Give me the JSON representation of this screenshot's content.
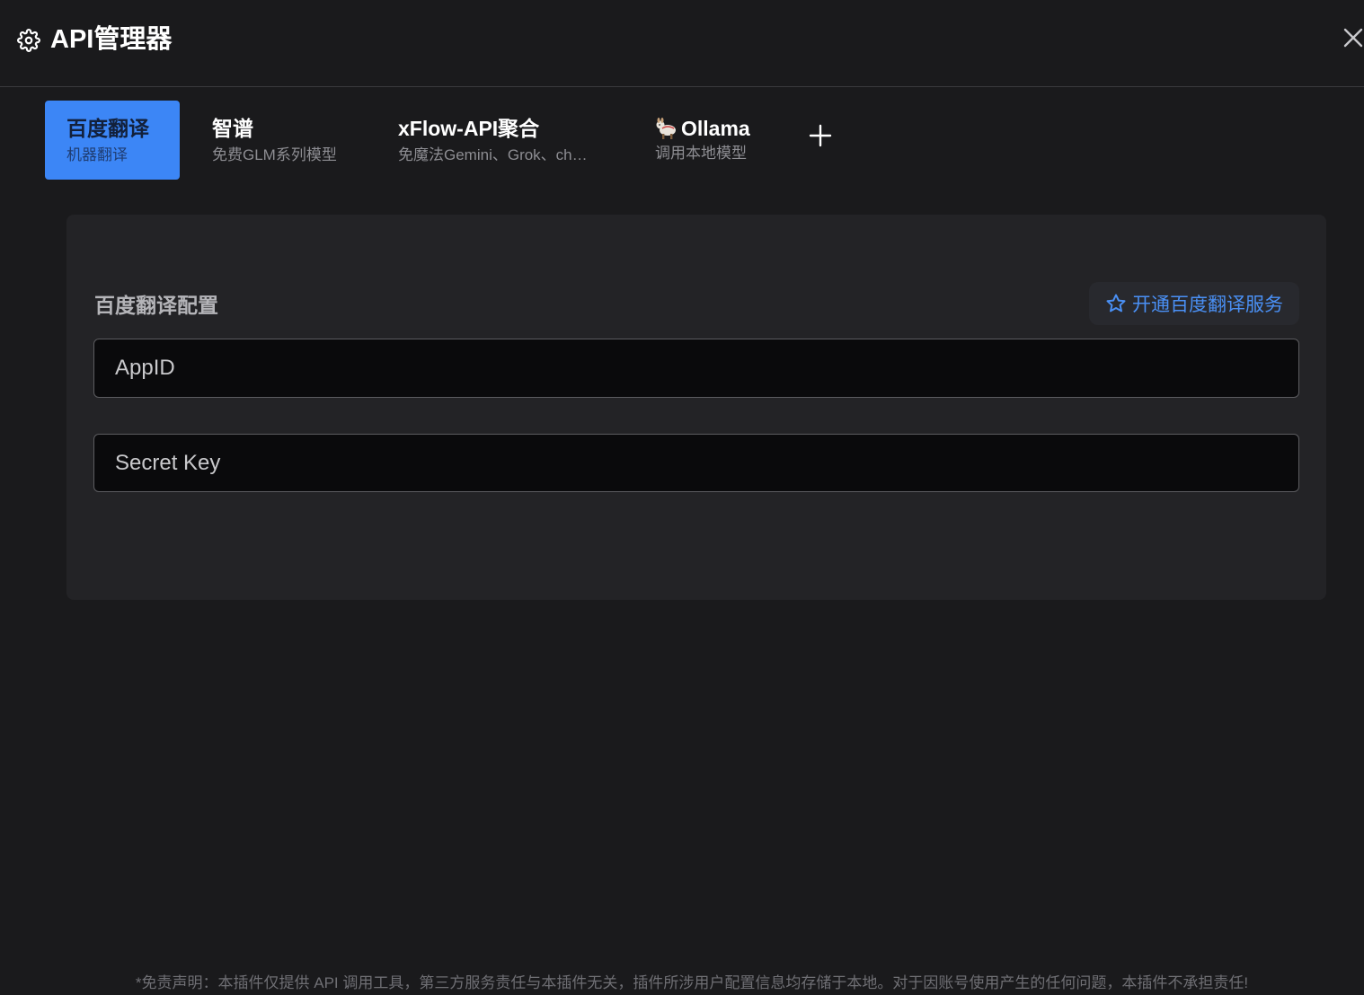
{
  "header": {
    "title": "API管理器",
    "gear_icon": "gear-icon",
    "close_icon": "close-icon"
  },
  "tabs": [
    {
      "title": "百度翻译",
      "subtitle": "机器翻译",
      "active": true
    },
    {
      "title": "智谱",
      "subtitle": "免费GLM系列模型",
      "active": false
    },
    {
      "title": "xFlow-API聚合",
      "subtitle": "免魔法Gemini、Grok、ch…",
      "active": false
    },
    {
      "title": "Ollama",
      "subtitle": "调用本地模型",
      "active": false,
      "icon": "llama-icon"
    }
  ],
  "add_tab_icon": "plus-icon",
  "panel": {
    "title": "百度翻译配置",
    "open_service_label": "开通百度翻译服务",
    "open_service_icon": "star-icon",
    "appid": {
      "placeholder": "AppID",
      "value": ""
    },
    "secret_key": {
      "placeholder": "Secret Key",
      "value": ""
    }
  },
  "footer": {
    "disclaimer": "*免责声明：本插件仅提供 API 调用工具，第三方服务责任与本插件无关，插件所涉用户配置信息均存储于本地。对于因账号使用产生的任何问题，本插件不承担责任!"
  },
  "colors": {
    "background": "#1a1a1c",
    "panel": "#232326",
    "accent": "#3c86f6",
    "link": "#4a90f5"
  }
}
